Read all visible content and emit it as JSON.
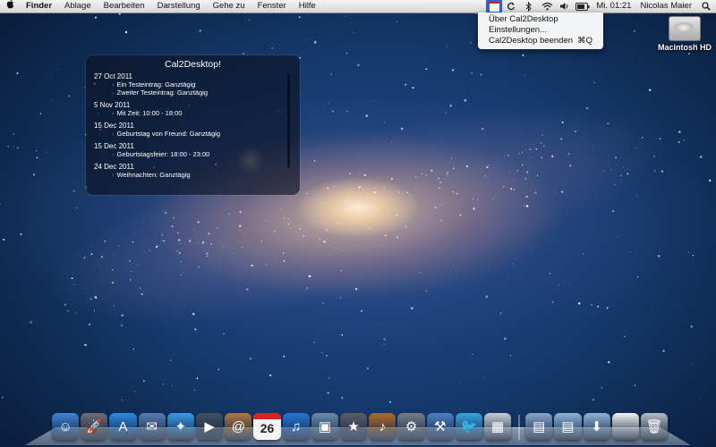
{
  "menubar": {
    "app_name": "Finder",
    "menus": [
      "Ablage",
      "Bearbeiten",
      "Darstellung",
      "Gehe zu",
      "Fenster",
      "Hilfe"
    ],
    "clock": "Mi. 01:21",
    "user": "Nicolas Maier",
    "status_icons": [
      "cal2desktop-icon",
      "sync-icon",
      "bluetooth-icon",
      "wifi-icon",
      "volume-icon",
      "battery-icon"
    ]
  },
  "app_menu": {
    "items": [
      {
        "label": "Über Cal2Desktop",
        "shortcut": ""
      },
      {
        "label": "Einstellungen...",
        "shortcut": ""
      },
      {
        "label": "Cal2Desktop beenden",
        "shortcut": "⌘Q"
      }
    ]
  },
  "desktop": {
    "drive_label": "Macintosh HD"
  },
  "widget": {
    "title": "Cal2Desktop!",
    "days": [
      {
        "date": "27 Oct 2011",
        "events": [
          "Ein Testeintrag: Ganztägig",
          "Zweiter Testeintrag: Ganztägig"
        ]
      },
      {
        "date": "5 Nov 2011",
        "events": [
          "Mit Zeit: 10:00 - 18:00"
        ]
      },
      {
        "date": "15 Dec 2011",
        "events": [
          "Geburtstag von Freund: Ganztägig"
        ]
      },
      {
        "date": "15 Dec 2011",
        "events": [
          "Geburtstagsfeier: 18:00 - 23:00"
        ]
      },
      {
        "date": "24 Dec 2011",
        "events": [
          "Weihnachten: Ganztägig"
        ]
      }
    ]
  },
  "dock": {
    "calendar_day": "26",
    "apps": [
      {
        "icon": "finder-icon",
        "color": "#3f86d6",
        "glyph": "☺"
      },
      {
        "icon": "launchpad-icon",
        "color": "#6d6f78",
        "glyph": "🚀"
      },
      {
        "icon": "app-store-icon",
        "color": "#2d8be0",
        "glyph": "A"
      },
      {
        "icon": "mail-stamp-icon",
        "color": "#5a7db0",
        "glyph": "✉"
      },
      {
        "icon": "safari-icon",
        "color": "#3c9ae2",
        "glyph": "✦"
      },
      {
        "icon": "facetime-icon",
        "color": "#44505e",
        "glyph": "▶"
      },
      {
        "icon": "address-book-icon",
        "color": "#b07a3c",
        "glyph": "@"
      },
      {
        "icon": "ical-icon",
        "color": "#f2f2f2",
        "glyph": ""
      },
      {
        "icon": "itunes-icon",
        "color": "#2a76d2",
        "glyph": "♫"
      },
      {
        "icon": "iphoto-icon",
        "color": "#6b8aa8",
        "glyph": "▣"
      },
      {
        "icon": "imovie-icon",
        "color": "#5d5d66",
        "glyph": "★"
      },
      {
        "icon": "garageband-icon",
        "color": "#b06a2a",
        "glyph": "♪"
      },
      {
        "icon": "system-preferences-icon",
        "color": "#7a7d86",
        "glyph": "⚙"
      },
      {
        "icon": "xcode-icon",
        "color": "#4d7fbf",
        "glyph": "⚒"
      },
      {
        "icon": "twitter-icon",
        "color": "#3aa4e0",
        "glyph": "🐦"
      },
      {
        "icon": "calculator-icon",
        "color": "#c9ccd2",
        "glyph": "▦"
      }
    ],
    "stacks": [
      {
        "icon": "applications-folder-icon",
        "color": "#8aa4c8",
        "glyph": "▤"
      },
      {
        "icon": "documents-folder-icon",
        "color": "#8fb4d8",
        "glyph": "▤"
      },
      {
        "icon": "downloads-folder-icon",
        "color": "#8fb4d8",
        "glyph": "⬇"
      },
      {
        "icon": "document-icon",
        "color": "#f4f4f4",
        "glyph": ""
      },
      {
        "icon": "trash-icon",
        "color": "#b7bcc4",
        "glyph": "🗑"
      }
    ]
  }
}
